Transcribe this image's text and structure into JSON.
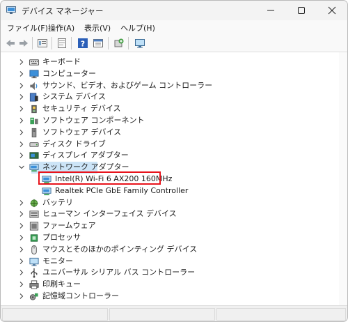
{
  "window": {
    "title": "デバイス マネージャー"
  },
  "menu": [
    {
      "label": "ファイル(F)"
    },
    {
      "label": "操作(A)"
    },
    {
      "label": "表示(V)"
    },
    {
      "label": "ヘルプ(H)"
    }
  ],
  "toolbar": {
    "icons": [
      "back-arrow-icon",
      "forward-arrow-icon",
      "properties-icon",
      "document-icon",
      "help-icon",
      "view-icon",
      "scan-hardware-icon",
      "monitor-icon"
    ]
  },
  "tree": [
    {
      "label": "キーボード",
      "icon": "keyboard-icon",
      "expanded": false
    },
    {
      "label": "コンピューター",
      "icon": "computer-icon",
      "expanded": false
    },
    {
      "label": "サウンド、ビデオ、およびゲーム コントローラー",
      "icon": "speaker-icon",
      "expanded": false
    },
    {
      "label": "システム デバイス",
      "icon": "system-device-icon",
      "expanded": false
    },
    {
      "label": "セキュリティ デバイス",
      "icon": "security-device-icon",
      "expanded": false
    },
    {
      "label": "ソフトウェア コンポーネント",
      "icon": "software-component-icon",
      "expanded": false
    },
    {
      "label": "ソフトウェア デバイス",
      "icon": "software-device-icon",
      "expanded": false
    },
    {
      "label": "ディスク ドライブ",
      "icon": "disk-drive-icon",
      "expanded": false
    },
    {
      "label": "ディスプレイ アダプター",
      "icon": "display-adapter-icon",
      "expanded": false
    },
    {
      "label": "ネットワーク アダプター",
      "icon": "network-adapter-icon",
      "expanded": true,
      "selected": true
    },
    {
      "label": "Intel(R) Wi-Fi 6 AX200 160MHz",
      "icon": "network-card-icon",
      "child": true
    },
    {
      "label": "Realtek PCIe GbE Family Controller",
      "icon": "network-card-icon",
      "child": true
    },
    {
      "label": "バッテリ",
      "icon": "battery-icon",
      "expanded": false
    },
    {
      "label": "ヒューマン インターフェイス デバイス",
      "icon": "hid-icon",
      "expanded": false
    },
    {
      "label": "ファームウェア",
      "icon": "firmware-icon",
      "expanded": false
    },
    {
      "label": "プロセッサ",
      "icon": "processor-icon",
      "expanded": false
    },
    {
      "label": "マウスとそのほかのポインティング デバイス",
      "icon": "mouse-icon",
      "expanded": false
    },
    {
      "label": "モニター",
      "icon": "monitor-icon",
      "expanded": false
    },
    {
      "label": "ユニバーサル シリアル バス コントローラー",
      "icon": "usb-icon",
      "expanded": false
    },
    {
      "label": "印刷キュー",
      "icon": "printer-icon",
      "expanded": false
    },
    {
      "label": "記憶域コントローラー",
      "icon": "storage-controller-icon",
      "expanded": false
    }
  ],
  "colors": {
    "highlight": "#e8141c",
    "selection": "#cce4f7"
  }
}
